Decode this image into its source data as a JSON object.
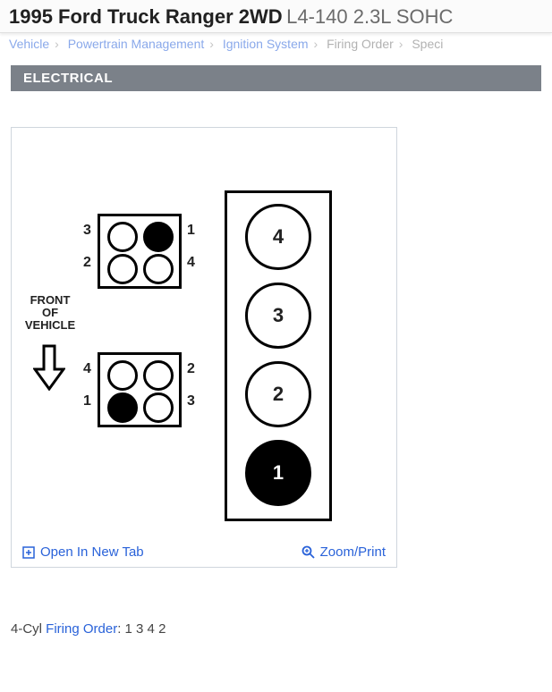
{
  "title": {
    "main": "1995 Ford Truck Ranger 2WD",
    "engine": "L4-140 2.3L SOHC"
  },
  "breadcrumb": {
    "items": [
      "Vehicle",
      "Powertrain Management",
      "Ignition System",
      "Firing Order",
      "Speci"
    ]
  },
  "section": {
    "label": "ELECTRICAL"
  },
  "diagram": {
    "front_label_l1": "FRONT",
    "front_label_l2": "OF",
    "front_label_l3": "VEHICLE",
    "coil_top": {
      "terminals": [
        {
          "pos": "tl",
          "filled": false
        },
        {
          "pos": "tr",
          "filled": true
        },
        {
          "pos": "bl",
          "filled": false
        },
        {
          "pos": "br",
          "filled": false
        }
      ],
      "labels": {
        "tl": "3",
        "tr": "1",
        "bl": "2",
        "br": "4"
      }
    },
    "coil_bottom": {
      "terminals": [
        {
          "pos": "tl",
          "filled": false
        },
        {
          "pos": "tr",
          "filled": false
        },
        {
          "pos": "bl",
          "filled": true
        },
        {
          "pos": "br",
          "filled": false
        }
      ],
      "labels": {
        "tl": "4",
        "tr": "2",
        "bl": "1",
        "br": "3"
      }
    },
    "cylinders": [
      {
        "num": "4",
        "filled": false
      },
      {
        "num": "3",
        "filled": false
      },
      {
        "num": "2",
        "filled": false
      },
      {
        "num": "1",
        "filled": true
      }
    ],
    "open_label": "Open In New Tab",
    "zoom_label": "Zoom/Print"
  },
  "footer_text": {
    "prefix": "4-Cyl ",
    "link": "Firing Order",
    "suffix": ": 1 3 4 2"
  }
}
